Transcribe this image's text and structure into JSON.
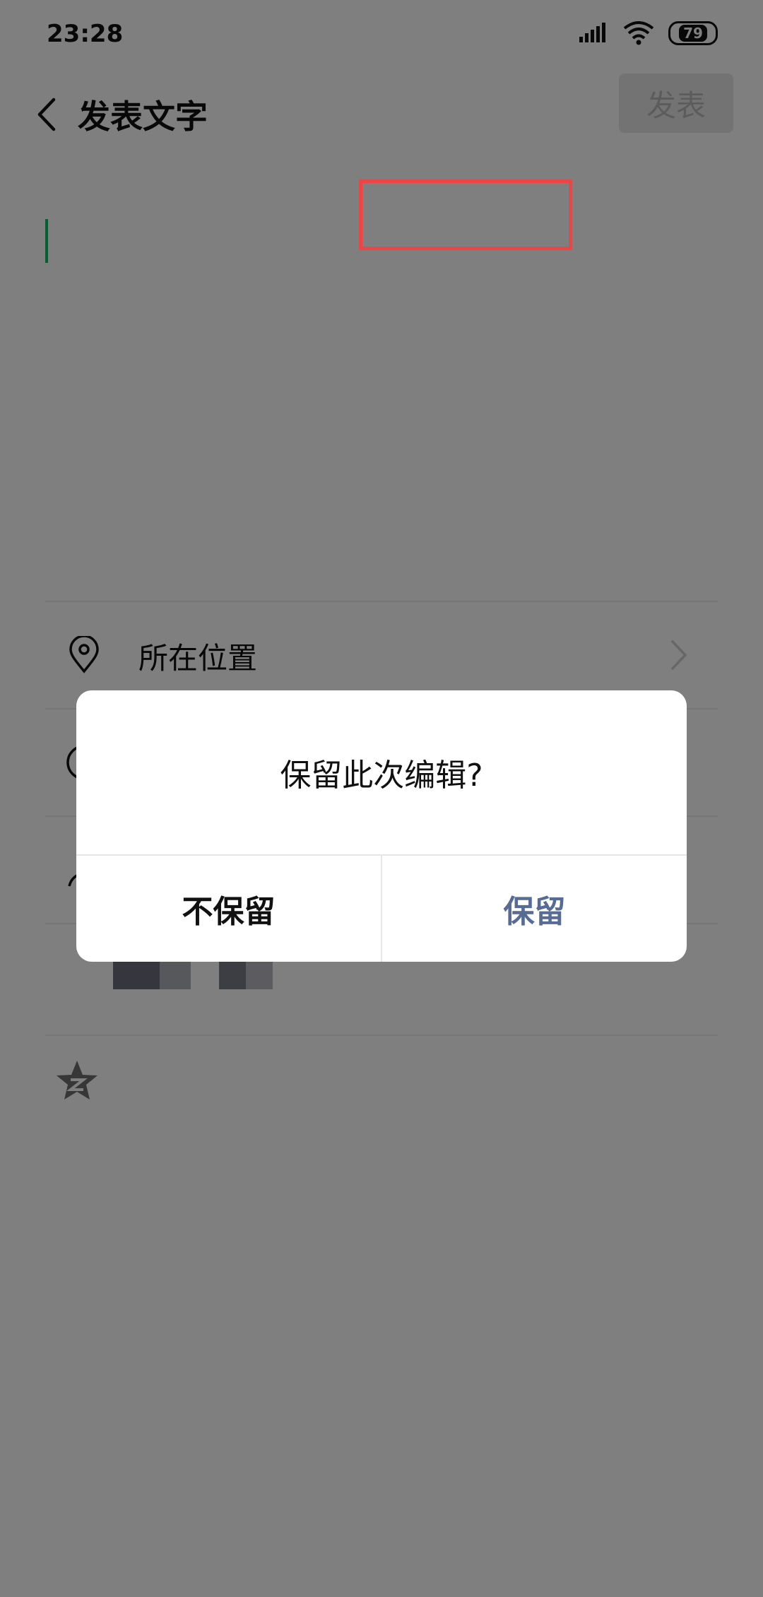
{
  "status_bar": {
    "time": "23:28",
    "battery": "79",
    "icons": [
      "signal-icon",
      "wifi-icon",
      "battery-icon"
    ]
  },
  "header": {
    "title": "发表文字",
    "publish_label": "发表"
  },
  "options": [
    {
      "label": "所在位置",
      "icon": "location-pin-icon"
    }
  ],
  "dialog": {
    "title": "保留此次编辑?",
    "discard_label": "不保留",
    "keep_label": "保留"
  },
  "colors": {
    "accent_green": "#07c160",
    "link_blue": "#576b95",
    "highlight_red": "#ef4444",
    "overlay": "rgba(0,0,0,0.5)"
  }
}
